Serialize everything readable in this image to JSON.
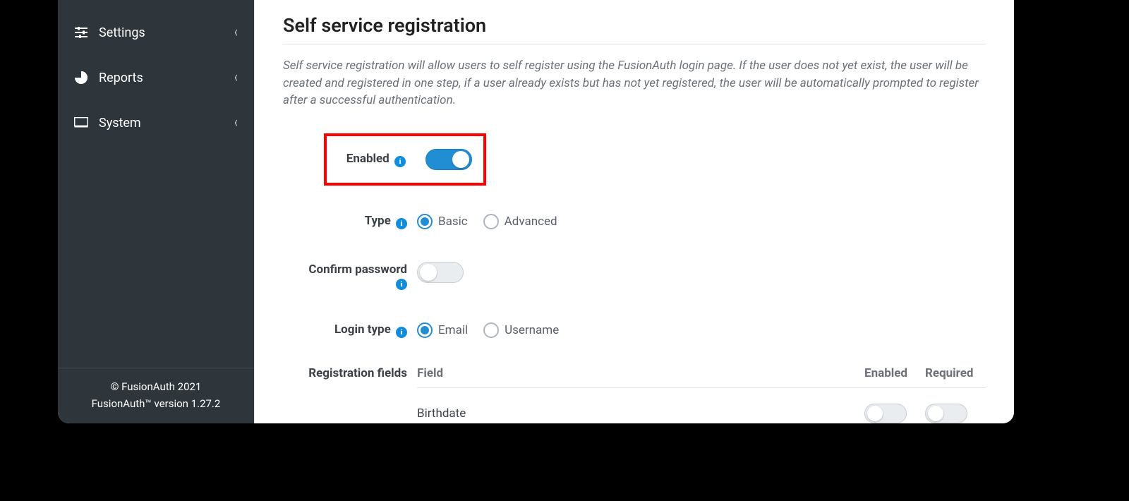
{
  "sidebar": {
    "items": [
      {
        "label": "Settings"
      },
      {
        "label": "Reports"
      },
      {
        "label": "System"
      }
    ],
    "footer": {
      "copyright": "© FusionAuth 2021",
      "version": "FusionAuth™ version 1.27.2"
    }
  },
  "main": {
    "title": "Self service registration",
    "desc": "Self service registration will allow users to self register using the FusionAuth login page. If the user does not yet exist, the user will be created and registered in one step, if a user already exists but has not yet registered, the user will be automatically prompted to register after a successful authentication.",
    "labels": {
      "enabled": "Enabled",
      "type": "Type",
      "confirm_password": "Confirm password",
      "login_type": "Login type",
      "registration_fields": "Registration fields"
    },
    "type": {
      "options": [
        "Basic",
        "Advanced"
      ],
      "selected": "Basic"
    },
    "login_type": {
      "options": [
        "Email",
        "Username"
      ],
      "selected": "Email"
    },
    "registration_fields": {
      "headers": {
        "field": "Field",
        "enabled": "Enabled",
        "required": "Required"
      },
      "rows": [
        {
          "field": "Birthdate",
          "enabled": false,
          "required": false
        }
      ]
    },
    "toggles": {
      "enabled": true,
      "confirm_password": false
    }
  }
}
